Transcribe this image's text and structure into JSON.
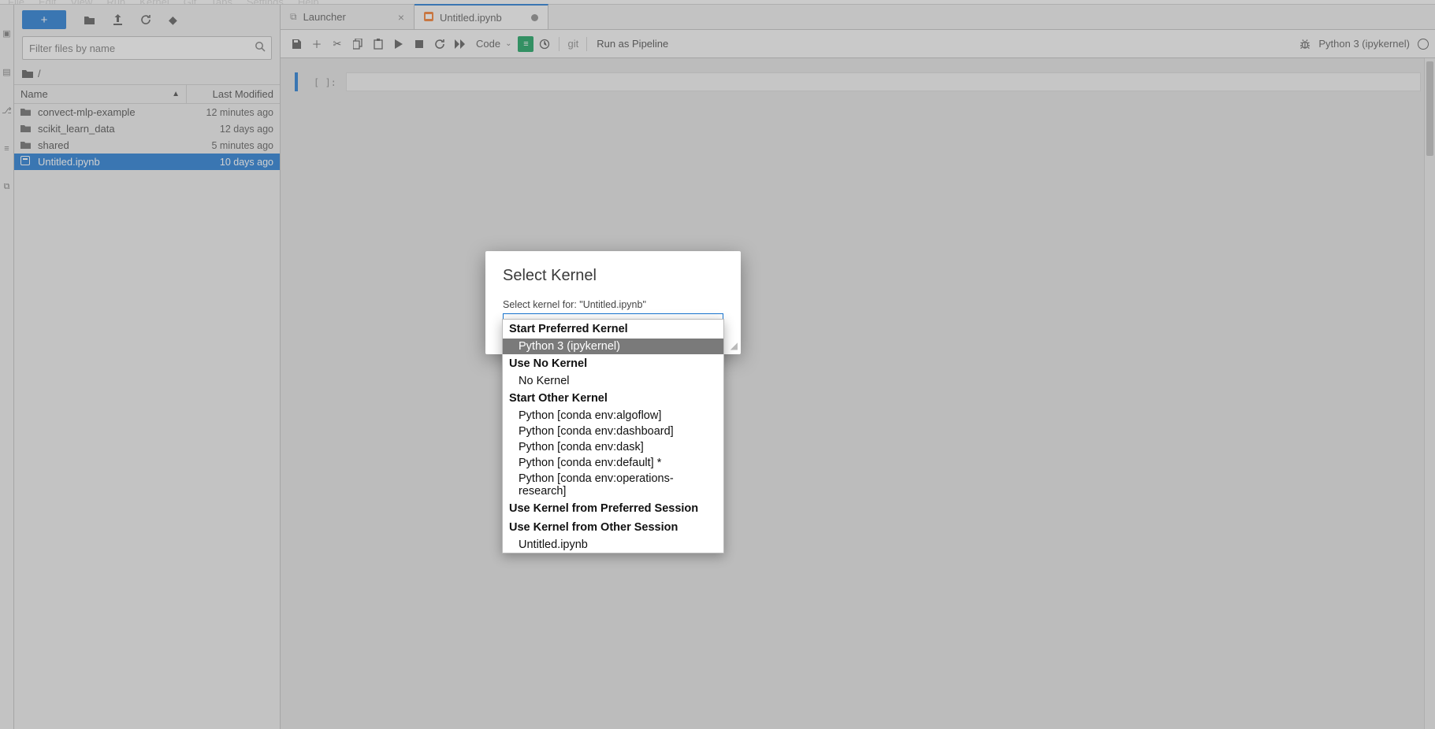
{
  "sidebar": {
    "plus_label": "+",
    "filter_placeholder": "Filter files by name",
    "breadcrumb": "/",
    "header": {
      "name": "Name",
      "modified": "Last Modified"
    },
    "files": [
      {
        "icon": "folder",
        "name": "convect-mlp-example",
        "modified": "12 minutes ago",
        "selected": false
      },
      {
        "icon": "folder",
        "name": "scikit_learn_data",
        "modified": "12 days ago",
        "selected": false
      },
      {
        "icon": "folder",
        "name": "shared",
        "modified": "5 minutes ago",
        "selected": false
      },
      {
        "icon": "notebook",
        "name": "Untitled.ipynb",
        "modified": "10 days ago",
        "selected": true
      }
    ]
  },
  "tabs": [
    {
      "icon": "launcher",
      "label": "Launcher",
      "active": false,
      "closable": true,
      "dirty": false
    },
    {
      "icon": "notebook",
      "label": "Untitled.ipynb",
      "active": true,
      "closable": false,
      "dirty": true
    }
  ],
  "nb_toolbar": {
    "cell_type": "Code",
    "git_label": "git",
    "run_pipeline": "Run as Pipeline",
    "kernel_display": "Python 3 (ipykernel)"
  },
  "cell": {
    "prompt": "[ ]:"
  },
  "dialog": {
    "title": "Select Kernel",
    "label": "Select kernel for: \"Untitled.ipynb\"",
    "selected": "Python 3 (ipykernel)"
  },
  "dropdown": {
    "groups": [
      {
        "heading": "Start Preferred Kernel",
        "items": [
          {
            "label": "Python 3 (ipykernel)",
            "hover": true
          }
        ]
      },
      {
        "heading": "Use No Kernel",
        "items": [
          {
            "label": "No Kernel"
          }
        ]
      },
      {
        "heading": "Start Other Kernel",
        "items": [
          {
            "label": "Python [conda env:algoflow]"
          },
          {
            "label": "Python [conda env:dashboard]"
          },
          {
            "label": "Python [conda env:dask]"
          },
          {
            "label": "Python [conda env:default] *"
          },
          {
            "label": "Python [conda env:operations-research]"
          }
        ]
      },
      {
        "heading": "Use Kernel from Preferred Session",
        "items": []
      },
      {
        "heading": "Use Kernel from Other Session",
        "items": [
          {
            "label": "Untitled.ipynb"
          }
        ]
      }
    ]
  }
}
